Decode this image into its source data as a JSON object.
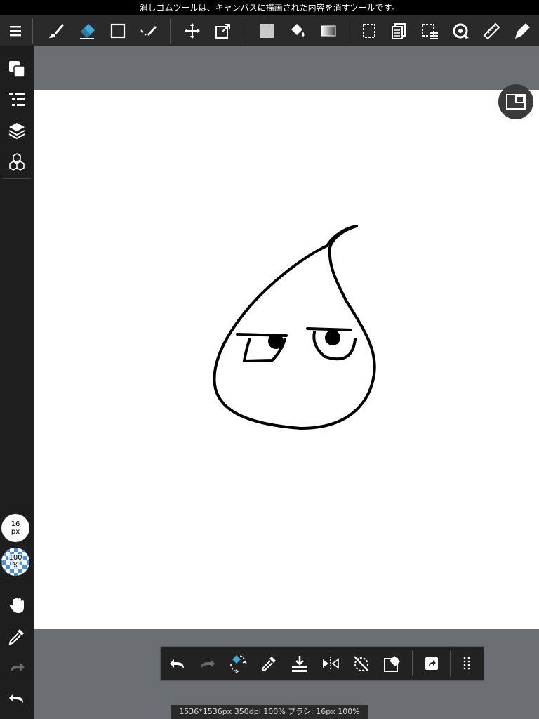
{
  "status_bar": {
    "message": "消しゴムツールは、キャンバスに描画された内容を消すツールです。"
  },
  "toolbar": {
    "items": [
      {
        "name": "menu-icon"
      },
      {
        "name": "brush-icon"
      },
      {
        "name": "eraser-icon",
        "selected": true
      },
      {
        "name": "shape-icon"
      },
      {
        "name": "select-pen-icon"
      },
      {
        "name": "move-icon"
      },
      {
        "name": "transform-icon"
      },
      {
        "name": "fill-color-icon"
      },
      {
        "name": "bucket-icon"
      },
      {
        "name": "gradient-icon"
      },
      {
        "name": "select-icon"
      },
      {
        "name": "copy-layer-icon"
      },
      {
        "name": "select-menu-icon"
      },
      {
        "name": "rotate-icon"
      },
      {
        "name": "ruler-icon"
      },
      {
        "name": "pen-icon"
      }
    ],
    "accent_color": "#3fa9d8"
  },
  "sidebar": {
    "brush_size": {
      "value": "16",
      "unit": "px"
    },
    "opacity": {
      "value": "100",
      "unit": "%"
    }
  },
  "info_bar": {
    "text": "1536*1536px 350dpi 100% ブラシ: 16px 100%"
  }
}
